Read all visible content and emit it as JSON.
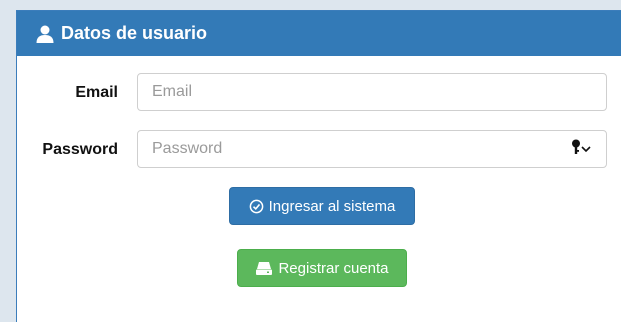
{
  "panel": {
    "title": "Datos de usuario",
    "icon": "user-icon",
    "header_color": "#337ab7"
  },
  "form": {
    "email": {
      "label": "Email",
      "placeholder": "Email",
      "value": ""
    },
    "password": {
      "label": "Password",
      "placeholder": "Password",
      "value": "",
      "toggle_icon": "key-icon"
    }
  },
  "buttons": {
    "login": {
      "label": "Ingresar al sistema",
      "icon": "check-circle-icon",
      "color": "#337ab7"
    },
    "register": {
      "label": "Registrar cuenta",
      "icon": "hdd-icon",
      "color": "#5cb85c"
    }
  }
}
